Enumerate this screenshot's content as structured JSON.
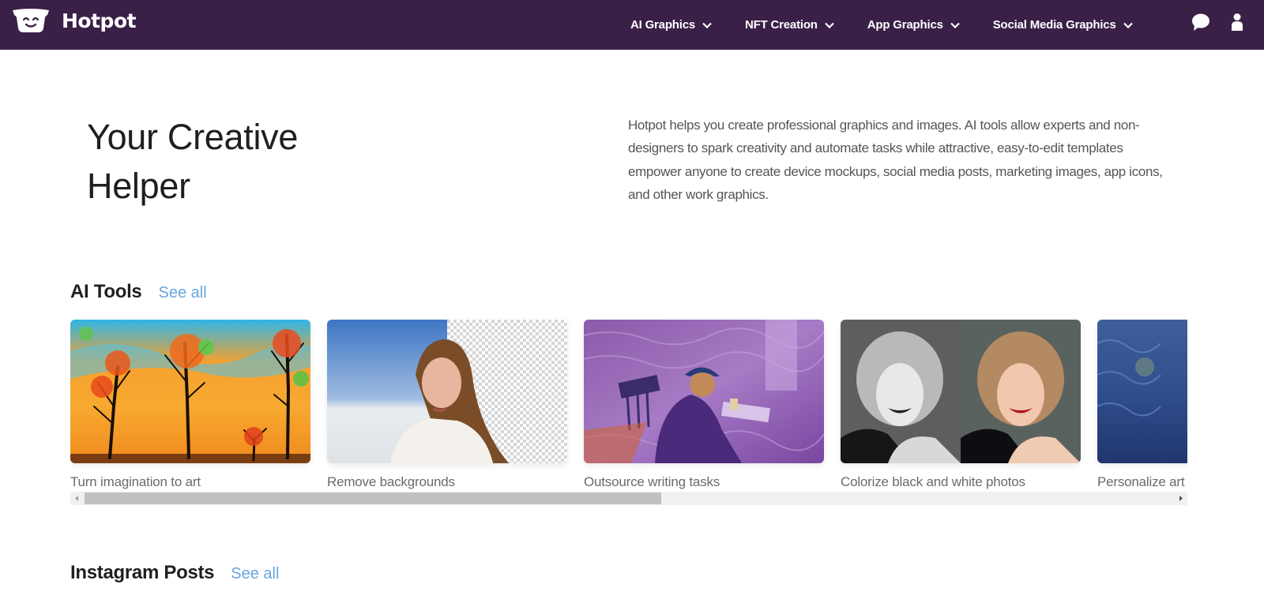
{
  "header": {
    "brand_name": "Hotpot",
    "background_color": "#3a1f47",
    "nav": [
      {
        "label": "AI Graphics",
        "icon": "chevron-down-icon"
      },
      {
        "label": "NFT Creation",
        "icon": "chevron-down-icon"
      },
      {
        "label": "App Graphics",
        "icon": "chevron-down-icon"
      },
      {
        "label": "Social Media Graphics",
        "icon": "chevron-down-icon"
      }
    ],
    "icons": [
      "chat-bubble-icon",
      "user-icon"
    ]
  },
  "hero": {
    "title_line1": "Your Creative",
    "title_line2": "Helper",
    "description": "Hotpot helps you create professional graphics and images. AI tools allow experts and non-designers to spark creativity and automate tasks while attractive, easy-to-edit templates empower anyone to create device mockups, social media posts, marketing images, app icons, and other work graphics."
  },
  "sections": [
    {
      "title": "AI Tools",
      "see_all": "See all",
      "cards": [
        {
          "label": "Turn imagination to art",
          "image": "painted-autumn-trees"
        },
        {
          "label": "Remove backgrounds",
          "image": "woman-background-removed"
        },
        {
          "label": "Outsource writing tasks",
          "image": "purple-stylized-writer"
        },
        {
          "label": "Colorize black and white photos",
          "image": "colorized-portrait"
        },
        {
          "label": "Personalize art",
          "image": "blue-impressionist-painting"
        }
      ],
      "scroll_position_fraction": 0.0,
      "scroll_visible_fraction": 0.53
    },
    {
      "title": "Instagram Posts",
      "see_all": "See all"
    }
  ],
  "colors": {
    "accent_link": "#6aa5e0",
    "heading_text": "#1f1f1f",
    "body_text": "#555555"
  }
}
